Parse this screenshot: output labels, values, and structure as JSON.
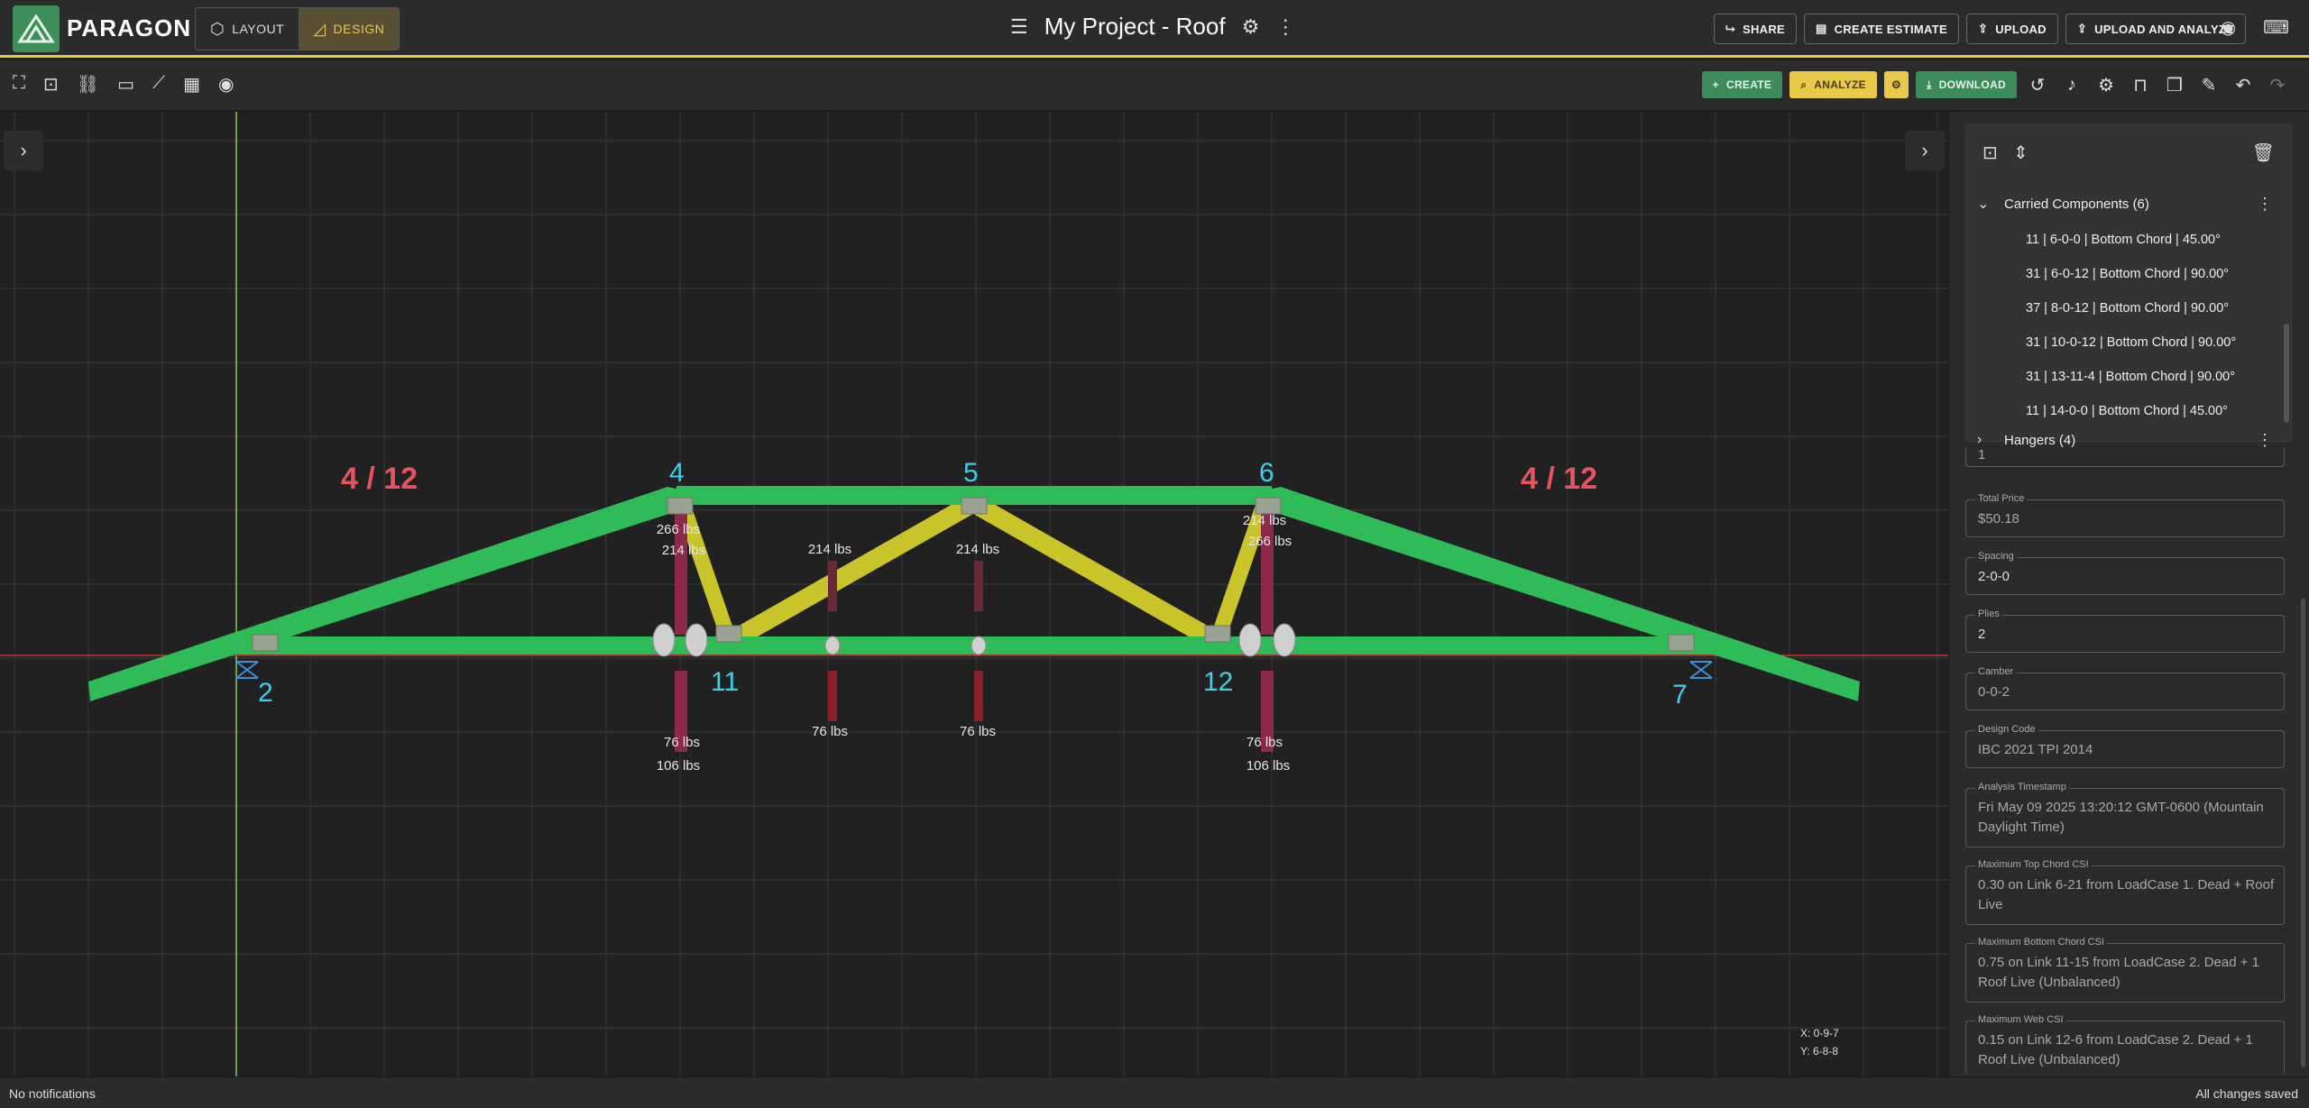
{
  "app": {
    "brand": "PARAGON",
    "brand_color": "#3f8f5a",
    "accent": "#e8c94a"
  },
  "modes": [
    {
      "label": "LAYOUT",
      "icon": "cube-icon"
    },
    {
      "label": "DESIGN",
      "icon": "pencil-ruler-icon",
      "active": true
    }
  ],
  "project": {
    "title": "My Project - Roof"
  },
  "top_actions": [
    {
      "label": "SHARE",
      "icon": "share-icon"
    },
    {
      "label": "CREATE ESTIMATE",
      "icon": "document-icon"
    },
    {
      "label": "UPLOAD",
      "icon": "upload-icon"
    },
    {
      "label": "UPLOAD AND ANALYZE",
      "icon": "upload-icon"
    }
  ],
  "toolbar": {
    "create_label": "CREATE",
    "analyze_label": "ANALYZE",
    "download_label": "DOWNLOAD"
  },
  "truss": {
    "pitch_left": "4 / 12",
    "pitch_right": "4 / 12",
    "nodes": [
      "2",
      "4",
      "5",
      "6",
      "7",
      "11",
      "12"
    ],
    "loads": {
      "n4_a": "266 lbs",
      "n4_b": "214 lbs",
      "web_left": "214 lbs",
      "web_mid": "214 lbs",
      "n6_a": "214 lbs",
      "n6_b": "266 lbs",
      "bot_l1": "76 lbs",
      "bot_l2": "106 lbs",
      "bot_m1": "76 lbs",
      "bot_m2": "76 lbs",
      "bot_r1": "76 lbs",
      "bot_r2": "106 lbs"
    },
    "chord_color": "#2fbb57",
    "web_color": "#c8c42a"
  },
  "coords": {
    "x": "X: 0-9-7",
    "y": "Y: 6-8-8"
  },
  "panel": {
    "carried_label": "Carried Components (6)",
    "carried": [
      "11 | 6-0-0 | Bottom Chord | 45.00°",
      "31 | 6-0-12 | Bottom Chord | 90.00°",
      "37 | 8-0-12 | Bottom Chord | 90.00°",
      "31 | 10-0-12 | Bottom Chord | 90.00°",
      "31 | 13-11-4 | Bottom Chord | 90.00°",
      "11 | 14-0-0 | Bottom Chord | 45.00°"
    ],
    "hangers_label": "Hangers (4)",
    "partial_value": "1",
    "fields": [
      {
        "label": "Total Price",
        "value": "$50.18",
        "readonly": true
      },
      {
        "label": "Spacing",
        "value": "2-0-0"
      },
      {
        "label": "Plies",
        "value": "2"
      },
      {
        "label": "Camber",
        "value": "0-0-2",
        "readonly": true
      },
      {
        "label": "Design Code",
        "value": "IBC 2021 TPI 2014",
        "readonly": true
      },
      {
        "label": "Analysis Timestamp",
        "value": "Fri May 09 2025 13:20:12 GMT-0600 (Mountain Daylight Time)",
        "readonly": true
      },
      {
        "label": "Maximum Top Chord CSI",
        "value": "0.30 on Link 6-21 from LoadCase 1. Dead + Roof Live",
        "readonly": true
      },
      {
        "label": "Maximum Bottom Chord CSI",
        "value": "0.75 on Link 11-15 from LoadCase 2. Dead + 1 Roof Live (Unbalanced)",
        "readonly": true
      },
      {
        "label": "Maximum Web CSI",
        "value": "0.15 on Link 12-6 from LoadCase 2. Dead + 1 Roof Live (Unbalanced)",
        "readonly": true
      }
    ]
  },
  "status": {
    "left": "No notifications",
    "right": "All changes saved"
  }
}
